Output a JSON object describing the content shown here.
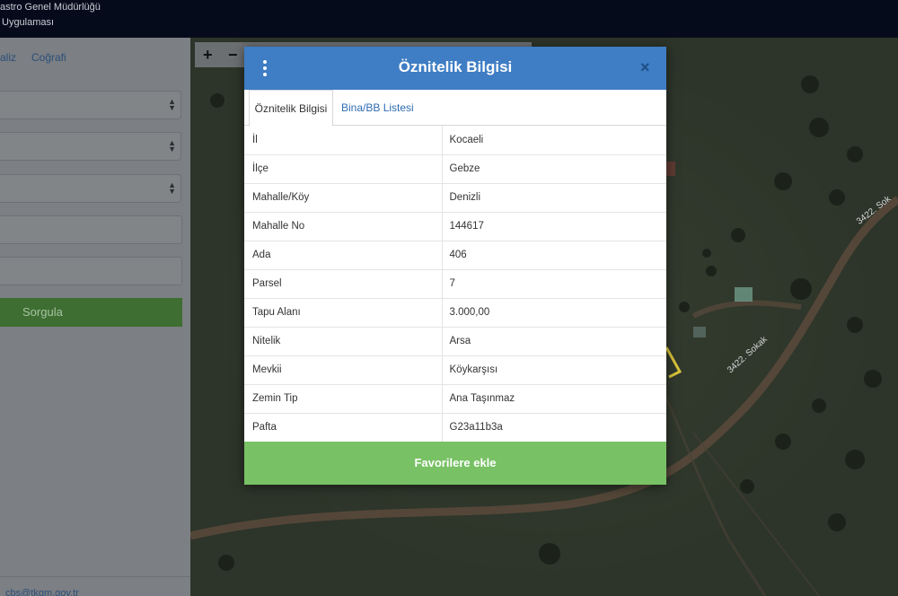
{
  "header": {
    "line1": "astro Genel Müdürlüğü",
    "line2": "Uygulaması"
  },
  "leftpanel": {
    "tabs": [
      "aliz",
      "Coğrafi"
    ],
    "query_button": "Sorgula",
    "footer_email": "cbs@tkgm.gov.tr"
  },
  "map": {
    "zoom_in": "+",
    "zoom_out": "−",
    "road_label_1": "3422. Sokak",
    "road_label_2": "3422. Sok"
  },
  "modal": {
    "title": "Öznitelik Bilgisi",
    "close_symbol": "×",
    "tabs": [
      {
        "label": "Öznitelik Bilgisi",
        "active": true
      },
      {
        "label": "Bina/BB Listesi",
        "active": false
      }
    ],
    "rows": [
      {
        "label": "İl",
        "value": "Kocaeli"
      },
      {
        "label": "İlçe",
        "value": "Gebze"
      },
      {
        "label": "Mahalle/Köy",
        "value": "Denizli"
      },
      {
        "label": "Mahalle No",
        "value": "144617"
      },
      {
        "label": "Ada",
        "value": "406"
      },
      {
        "label": "Parsel",
        "value": "7"
      },
      {
        "label": "Tapu Alanı",
        "value": "3.000,00"
      },
      {
        "label": "Nitelik",
        "value": "Arsa"
      },
      {
        "label": "Mevkii",
        "value": "Köykarşısı"
      },
      {
        "label": "Zemin Tip",
        "value": "Ana Taşınmaz"
      },
      {
        "label": "Pafta",
        "value": "G23a11b3a"
      }
    ],
    "favorite_button": "Favorilere ekle"
  },
  "colors": {
    "header_blue": "#3f7dc4",
    "favorite_green": "#78c165",
    "topbar_navy": "#060b1c"
  },
  "icons": {
    "menu": "kebab-menu-icon",
    "close": "close-icon",
    "select_arrows": "select-arrows-icon"
  }
}
